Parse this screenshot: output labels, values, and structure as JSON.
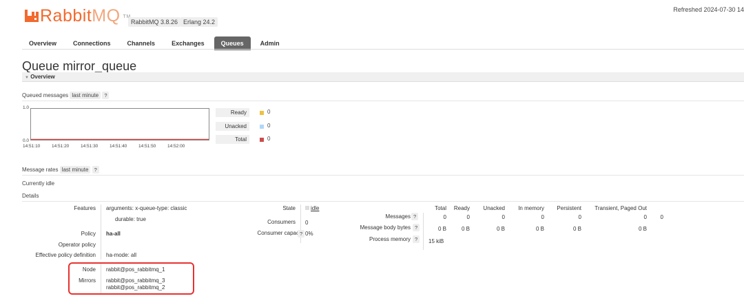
{
  "header": {
    "logo_text_rabbit": "Rabbit",
    "logo_text_mq": "MQ",
    "logo_tm": "TM",
    "version_rabbit": "RabbitMQ 3.8.26",
    "version_erlang": "Erlang 24.2",
    "refreshed": "Refreshed 2024-07-30 14"
  },
  "nav": {
    "tabs": [
      {
        "label": "Overview"
      },
      {
        "label": "Connections"
      },
      {
        "label": "Channels"
      },
      {
        "label": "Exchanges"
      },
      {
        "label": "Queues"
      },
      {
        "label": "Admin"
      }
    ],
    "active": "Queues"
  },
  "page": {
    "title_prefix": "Queue",
    "title_name": "mirror_queue",
    "section_overview": "Overview"
  },
  "queued_messages": {
    "label": "Queued messages",
    "range": "last minute",
    "help": "?",
    "ymax": "1.0",
    "ymin": "0.0",
    "x_ticks": [
      "14:51:10",
      "14:51:20",
      "14:51:30",
      "14:51:40",
      "14:51:50",
      "14:52:00"
    ],
    "legend": [
      {
        "label": "Ready",
        "value": "0",
        "color": "#edc240"
      },
      {
        "label": "Unacked",
        "value": "0",
        "color": "#afd8f8"
      },
      {
        "label": "Total",
        "value": "0",
        "color": "#cb4b4b"
      }
    ]
  },
  "message_rates": {
    "label": "Message rates",
    "range": "last minute",
    "help": "?",
    "status": "Currently idle"
  },
  "details": {
    "label": "Details",
    "features_label": "Features",
    "features_arguments_key": "arguments:",
    "features_arguments_value": "x-queue-type: classic",
    "features_durable_key": "durable:",
    "features_durable_value": "true",
    "policy_label": "Policy",
    "policy_value": "ha-all",
    "operator_policy_label": "Operator policy",
    "effective_policy_label": "Effective policy definition",
    "effective_policy_value_key": "ha-mode:",
    "effective_policy_value": "all",
    "node_label": "Node",
    "node_value": "rabbit@pos_rabbitmq_1",
    "mirrors_label": "Mirrors",
    "mirrors": [
      "rabbit@pos_rabbitmq_3",
      "rabbit@pos_rabbitmq_2"
    ],
    "state_label": "State",
    "state_value": "idle",
    "consumers_label": "Consumers",
    "consumers_value": "0",
    "consumer_capacity_label": "Consumer capacity",
    "consumer_capacity_value": "0%",
    "help": "?"
  },
  "stats": {
    "columns": [
      "Total",
      "Ready",
      "Unacked",
      "In memory",
      "Persistent",
      "Transient, Paged Out"
    ],
    "messages_label": "Messages",
    "messages": [
      "0",
      "0",
      "0",
      "0",
      "0",
      "0",
      "0"
    ],
    "body_bytes_label": "Message body bytes",
    "body_bytes": [
      "0 B",
      "0 B",
      "0 B",
      "0 B",
      "0 B",
      "0 B"
    ],
    "process_memory_label": "Process memory",
    "process_memory": "15 kiB"
  }
}
